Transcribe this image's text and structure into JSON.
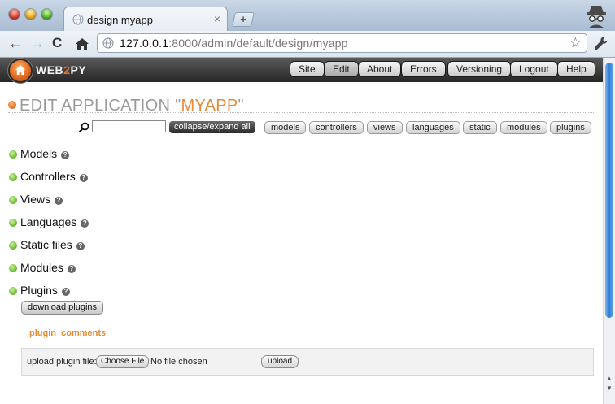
{
  "browser": {
    "tab_title": "design myapp",
    "tab_close": "×",
    "new_tab": "+",
    "url_host": "127.0.0.1",
    "url_rest": ":8000/admin/default/design/myapp",
    "back": "←",
    "forward": "→",
    "reload": "C",
    "bookmark_star": "☆"
  },
  "header": {
    "logo_pre": "WEB",
    "logo_two": "2",
    "logo_post": "PY",
    "menu": [
      "Site",
      "Edit",
      "About",
      "Errors",
      "Versioning",
      "Logout",
      "Help"
    ]
  },
  "page": {
    "title_prefix": "EDIT APPLICATION \"",
    "app_name": "MYAPP",
    "title_suffix": "\"",
    "collapse_label": "collapse/expand all",
    "filters": [
      "models",
      "controllers",
      "views",
      "languages",
      "static",
      "modules",
      "plugins"
    ],
    "sections": [
      "Models",
      "Controllers",
      "Views",
      "Languages",
      "Static files",
      "Modules",
      "Plugins"
    ],
    "help_mark": "?",
    "download_plugins": "download plugins",
    "plugin_name": "plugin_comments",
    "upload_label": "upload plugin file:",
    "choose_file": "Choose File",
    "no_file": "No file chosen",
    "upload_button": "upload"
  }
}
